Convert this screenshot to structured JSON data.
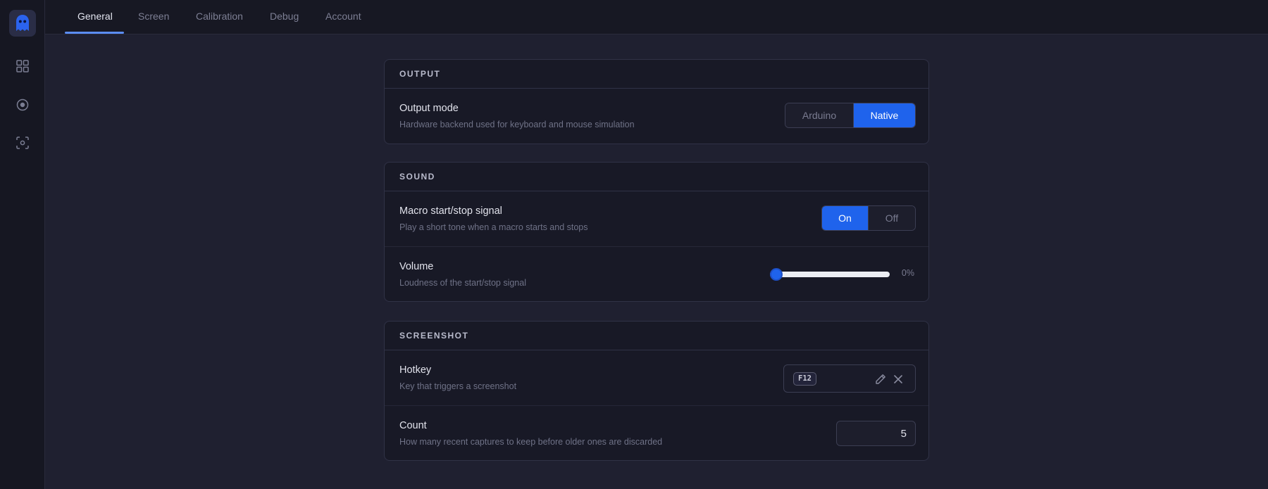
{
  "tabs": [
    "General",
    "Screen",
    "Calibration",
    "Debug",
    "Account"
  ],
  "active_tab": "General",
  "sidebar": {
    "icons": [
      "ghost-logo-icon",
      "grid-icon",
      "target-icon",
      "scan-icon"
    ]
  },
  "output": {
    "header": "OUTPUT",
    "mode": {
      "title": "Output mode",
      "description": "Hardware backend used for keyboard and mouse simulation",
      "options": [
        "Arduino",
        "Native"
      ],
      "selected": "Native"
    }
  },
  "sound": {
    "header": "SOUND",
    "signal": {
      "title": "Macro start/stop signal",
      "description": "Play a short tone when a macro starts and stops",
      "options": [
        "On",
        "Off"
      ],
      "selected": "On"
    },
    "volume": {
      "title": "Volume",
      "description": "Loudness of the start/stop signal",
      "value_percent": 0,
      "value_label": "0%"
    }
  },
  "screenshot": {
    "header": "SCREENSHOT",
    "hotkey": {
      "title": "Hotkey",
      "description": "Key that triggers a screenshot",
      "key": "F12"
    },
    "count": {
      "title": "Count",
      "description": "How many recent captures to keep before older ones are discarded",
      "value": "5"
    }
  },
  "colors": {
    "accent": "#1f63ec",
    "tab_underline": "#5b8df6",
    "background": "#1f2030",
    "card": "#181926"
  }
}
